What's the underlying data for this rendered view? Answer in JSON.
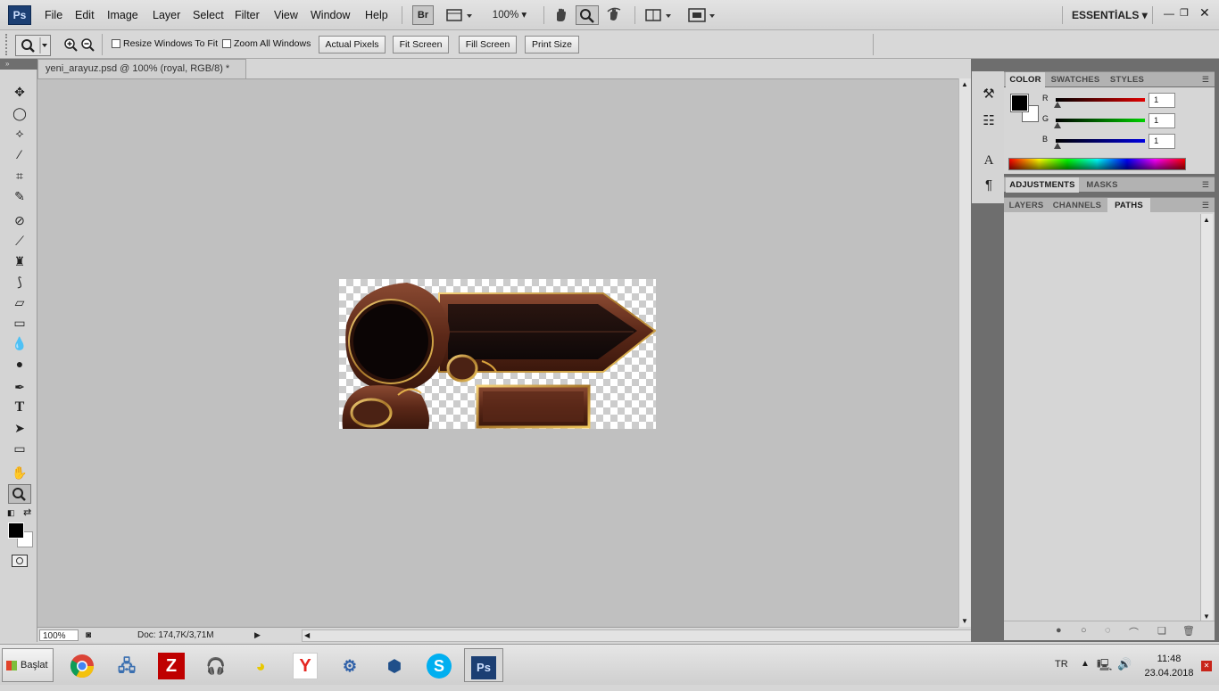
{
  "app": {
    "logo": "Ps"
  },
  "menu": [
    "File",
    "Edit",
    "Image",
    "Layer",
    "Select",
    "Filter",
    "View",
    "Window",
    "Help"
  ],
  "appbar": {
    "bridge_label": "Br",
    "zoom_level": "100%",
    "workspace": "ESSENTİALS"
  },
  "options": {
    "resize_windows_label": "Resize Windows To Fit",
    "zoom_all_label": "Zoom All Windows",
    "buttons": [
      "Actual Pixels",
      "Fit Screen",
      "Fill Screen",
      "Print Size"
    ]
  },
  "document": {
    "tab_title": "yeni_arayuz.psd @ 100% (royal, RGB/8) *",
    "zoom": "100%",
    "doc_info": "Doc: 174,7K/3,71M"
  },
  "color_panel": {
    "tabs": [
      "COLOR",
      "SWATCHES",
      "STYLES"
    ],
    "channels": [
      {
        "label": "R",
        "value": "1",
        "color": "#e00000"
      },
      {
        "label": "G",
        "value": "1",
        "color": "#00d000"
      },
      {
        "label": "B",
        "value": "1",
        "color": "#0000e0"
      }
    ]
  },
  "adjustments_panel": {
    "tabs": [
      "ADJUSTMENTS",
      "MASKS"
    ]
  },
  "layers_panel": {
    "tabs": [
      "LAYERS",
      "CHANNELS",
      "PATHS"
    ]
  },
  "icons": {
    "hand": "hand-icon",
    "zoom": "zoom-icon",
    "rotate": "rotate-view-icon",
    "arrange": "arrange-documents-icon",
    "screen_mode": "screen-mode-icon"
  },
  "taskbar": {
    "start_label": "Başlat",
    "apps": [
      "Chrome",
      "Network",
      "FileZilla",
      "Headset",
      "Pidgin",
      "Yandex",
      "Toolkit",
      "VirtualBox",
      "Skype",
      "Photoshop"
    ],
    "language": "TR",
    "time": "11:48",
    "date": "23.04.2018"
  }
}
